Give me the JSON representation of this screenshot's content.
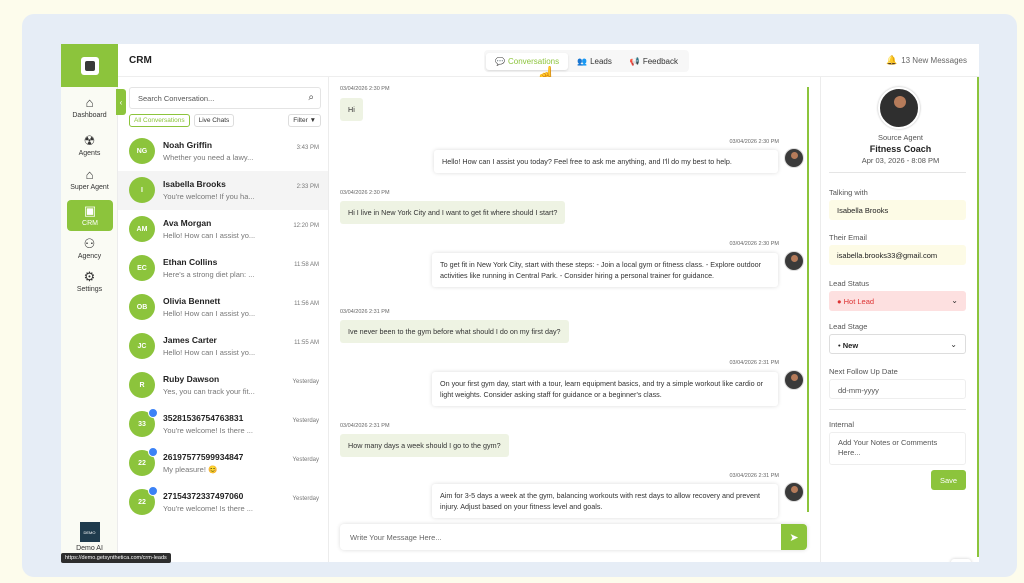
{
  "header": {
    "title": "CRM",
    "tabs": [
      {
        "label": "Conversations",
        "icon": "chat-bubbles-icon"
      },
      {
        "label": "Leads",
        "icon": "users-icon"
      },
      {
        "label": "Feedback",
        "icon": "megaphone-icon"
      }
    ],
    "new_messages": "13 New Messages"
  },
  "nav": {
    "items": [
      {
        "label": "Dashboard",
        "icon": "home-icon"
      },
      {
        "label": "Agents",
        "icon": "robot-icon"
      },
      {
        "label": "Super Agent",
        "icon": "building-icon"
      },
      {
        "label": "CRM",
        "icon": "crm-icon"
      },
      {
        "label": "Agency",
        "icon": "group-icon"
      },
      {
        "label": "Settings",
        "icon": "gear-icon"
      }
    ],
    "bottom_label": "Demo AI",
    "bottom_thumb_text": "DEMO"
  },
  "conversations": {
    "search_placeholder": "Search Conversation...",
    "filters": [
      "All Conversations",
      "Live Chats"
    ],
    "filter_button": "Filter",
    "items": [
      {
        "initials": "NG",
        "name": "Noah Griffin",
        "preview": "Whether you need a lawy...",
        "time": "3:43 PM",
        "whatsapp": false
      },
      {
        "initials": "I",
        "name": "Isabella Brooks",
        "preview": "You're welcome! If you ha...",
        "time": "2:33 PM",
        "whatsapp": false
      },
      {
        "initials": "AM",
        "name": "Ava Morgan",
        "preview": "Hello! How can I assist yo...",
        "time": "12:20 PM",
        "whatsapp": false
      },
      {
        "initials": "EC",
        "name": "Ethan Collins",
        "preview": "Here's a strong diet plan: ...",
        "time": "11:58 AM",
        "whatsapp": false
      },
      {
        "initials": "OB",
        "name": "Olivia Bennett",
        "preview": "Hello! How can I assist yo...",
        "time": "11:56 AM",
        "whatsapp": false
      },
      {
        "initials": "JC",
        "name": "James Carter",
        "preview": "Hello! How can I assist yo...",
        "time": "11:55 AM",
        "whatsapp": false
      },
      {
        "initials": "R",
        "name": "Ruby Dawson",
        "preview": "Yes, you can track your fit...",
        "time": "Yesterday",
        "whatsapp": false
      },
      {
        "initials": "33",
        "name": "35281536754763831",
        "preview": "You're welcome! Is there ...",
        "time": "Yesterday",
        "whatsapp": true
      },
      {
        "initials": "22",
        "name": "26197577599934847",
        "preview": "My pleasure! 😊",
        "time": "Yesterday",
        "whatsapp": true
      },
      {
        "initials": "22",
        "name": "27154372337497060",
        "preview": "You're welcome! Is there ...",
        "time": "Yesterday",
        "whatsapp": true
      }
    ]
  },
  "chat": {
    "messages": [
      {
        "dir": "in",
        "time": "03/04/2026 2:30 PM",
        "text": "Hi"
      },
      {
        "dir": "out",
        "time": "03/04/2026 2:30 PM",
        "text": "Hello! How can I assist you today? Feel free to ask me anything, and I'll do my best to help."
      },
      {
        "dir": "in",
        "time": "03/04/2026 2:30 PM",
        "text": "Hi I live in New York City and I want to get fit where should I start?"
      },
      {
        "dir": "out",
        "time": "03/04/2026 2:30 PM",
        "text": "To get fit in New York City, start with these steps: - Join a local gym or fitness class. - Explore outdoor activities like running in Central Park. - Consider hiring a personal trainer for guidance."
      },
      {
        "dir": "in",
        "time": "03/04/2026 2:31 PM",
        "text": "Ive never been to the gym before what should I do on my first day?"
      },
      {
        "dir": "out",
        "time": "03/04/2026 2:31 PM",
        "text": "On your first gym day, start with a tour, learn equipment basics, and try a simple workout like cardio or light weights. Consider asking staff for guidance or a beginner's class."
      },
      {
        "dir": "in",
        "time": "03/04/2026 2:31 PM",
        "text": "How many days a week should I go to the gym?"
      },
      {
        "dir": "out",
        "time": "03/04/2026 2:31 PM",
        "text": "Aim for 3-5 days a week at the gym, balancing workouts with rest days to allow recovery and prevent injury. Adjust based on your fitness level and goals."
      }
    ],
    "composer_placeholder": "Write Your Message Here..."
  },
  "details": {
    "source_label": "Source Agent",
    "agent_name": "Fitness Coach",
    "agent_date": "Apr 03, 2026 - 8:08 PM",
    "talking_with_label": "Talking with",
    "talking_with": "Isabella Brooks",
    "email_label": "Their Email",
    "email": "isabella.brooks33@gmail.com",
    "lead_status_label": "Lead Status",
    "lead_status": "Hot Lead",
    "lead_stage_label": "Lead Stage",
    "lead_stage": "New",
    "follow_up_label": "Next Follow Up Date",
    "follow_up_placeholder": "dd-mm-yyyy",
    "internal_label": "Internal",
    "notes_placeholder": "Add Your Notes or Comments Here...",
    "save_label": "Save"
  },
  "status_url": "https://demo.getsynthetica.com/crm-leads",
  "colors": {
    "accent": "#8cc43c",
    "hot": "#d33333",
    "bubble_in": "#eef3e3"
  }
}
